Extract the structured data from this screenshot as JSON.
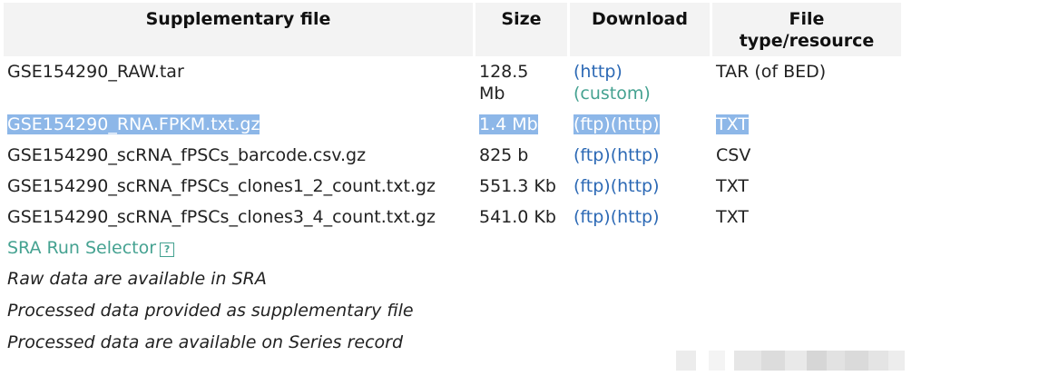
{
  "table": {
    "headers": {
      "file": "Supplementary file",
      "size": "Size",
      "download": "Download",
      "type_line1": "File",
      "type_line2": "type/resource"
    },
    "rows": [
      {
        "file": "GSE154290_RAW.tar",
        "size": "128.5 Mb",
        "links": [
          "(http)",
          "(custom)"
        ],
        "type": "TAR (of BED)",
        "selected": false
      },
      {
        "file": "GSE154290_RNA.FPKM.txt.gz",
        "size": "1.4 Mb",
        "links": [
          "(ftp)",
          "(http)"
        ],
        "type": "TXT",
        "selected": true
      },
      {
        "file": "GSE154290_scRNA_fPSCs_barcode.csv.gz",
        "size": "825 b",
        "links": [
          "(ftp)",
          "(http)"
        ],
        "type": "CSV",
        "selected": false
      },
      {
        "file": "GSE154290_scRNA_fPSCs_clones1_2_count.txt.gz",
        "size": "551.3 Kb",
        "links": [
          "(ftp)",
          "(http)"
        ],
        "type": "TXT",
        "selected": false
      },
      {
        "file": "GSE154290_scRNA_fPSCs_clones3_4_count.txt.gz",
        "size": "541.0 Kb",
        "links": [
          "(ftp)",
          "(http)"
        ],
        "type": "TXT",
        "selected": false
      }
    ]
  },
  "sra": {
    "link_label": "SRA Run Selector",
    "help_glyph": "?"
  },
  "notes": [
    "Raw data are available in SRA",
    "Processed data provided as supplementary file",
    "Processed data are available on Series record"
  ],
  "colors": {
    "link": "#2c69b5",
    "link_alt": "#45a291",
    "selection": "#8db7e8",
    "header_bg": "#f3f3f3"
  }
}
